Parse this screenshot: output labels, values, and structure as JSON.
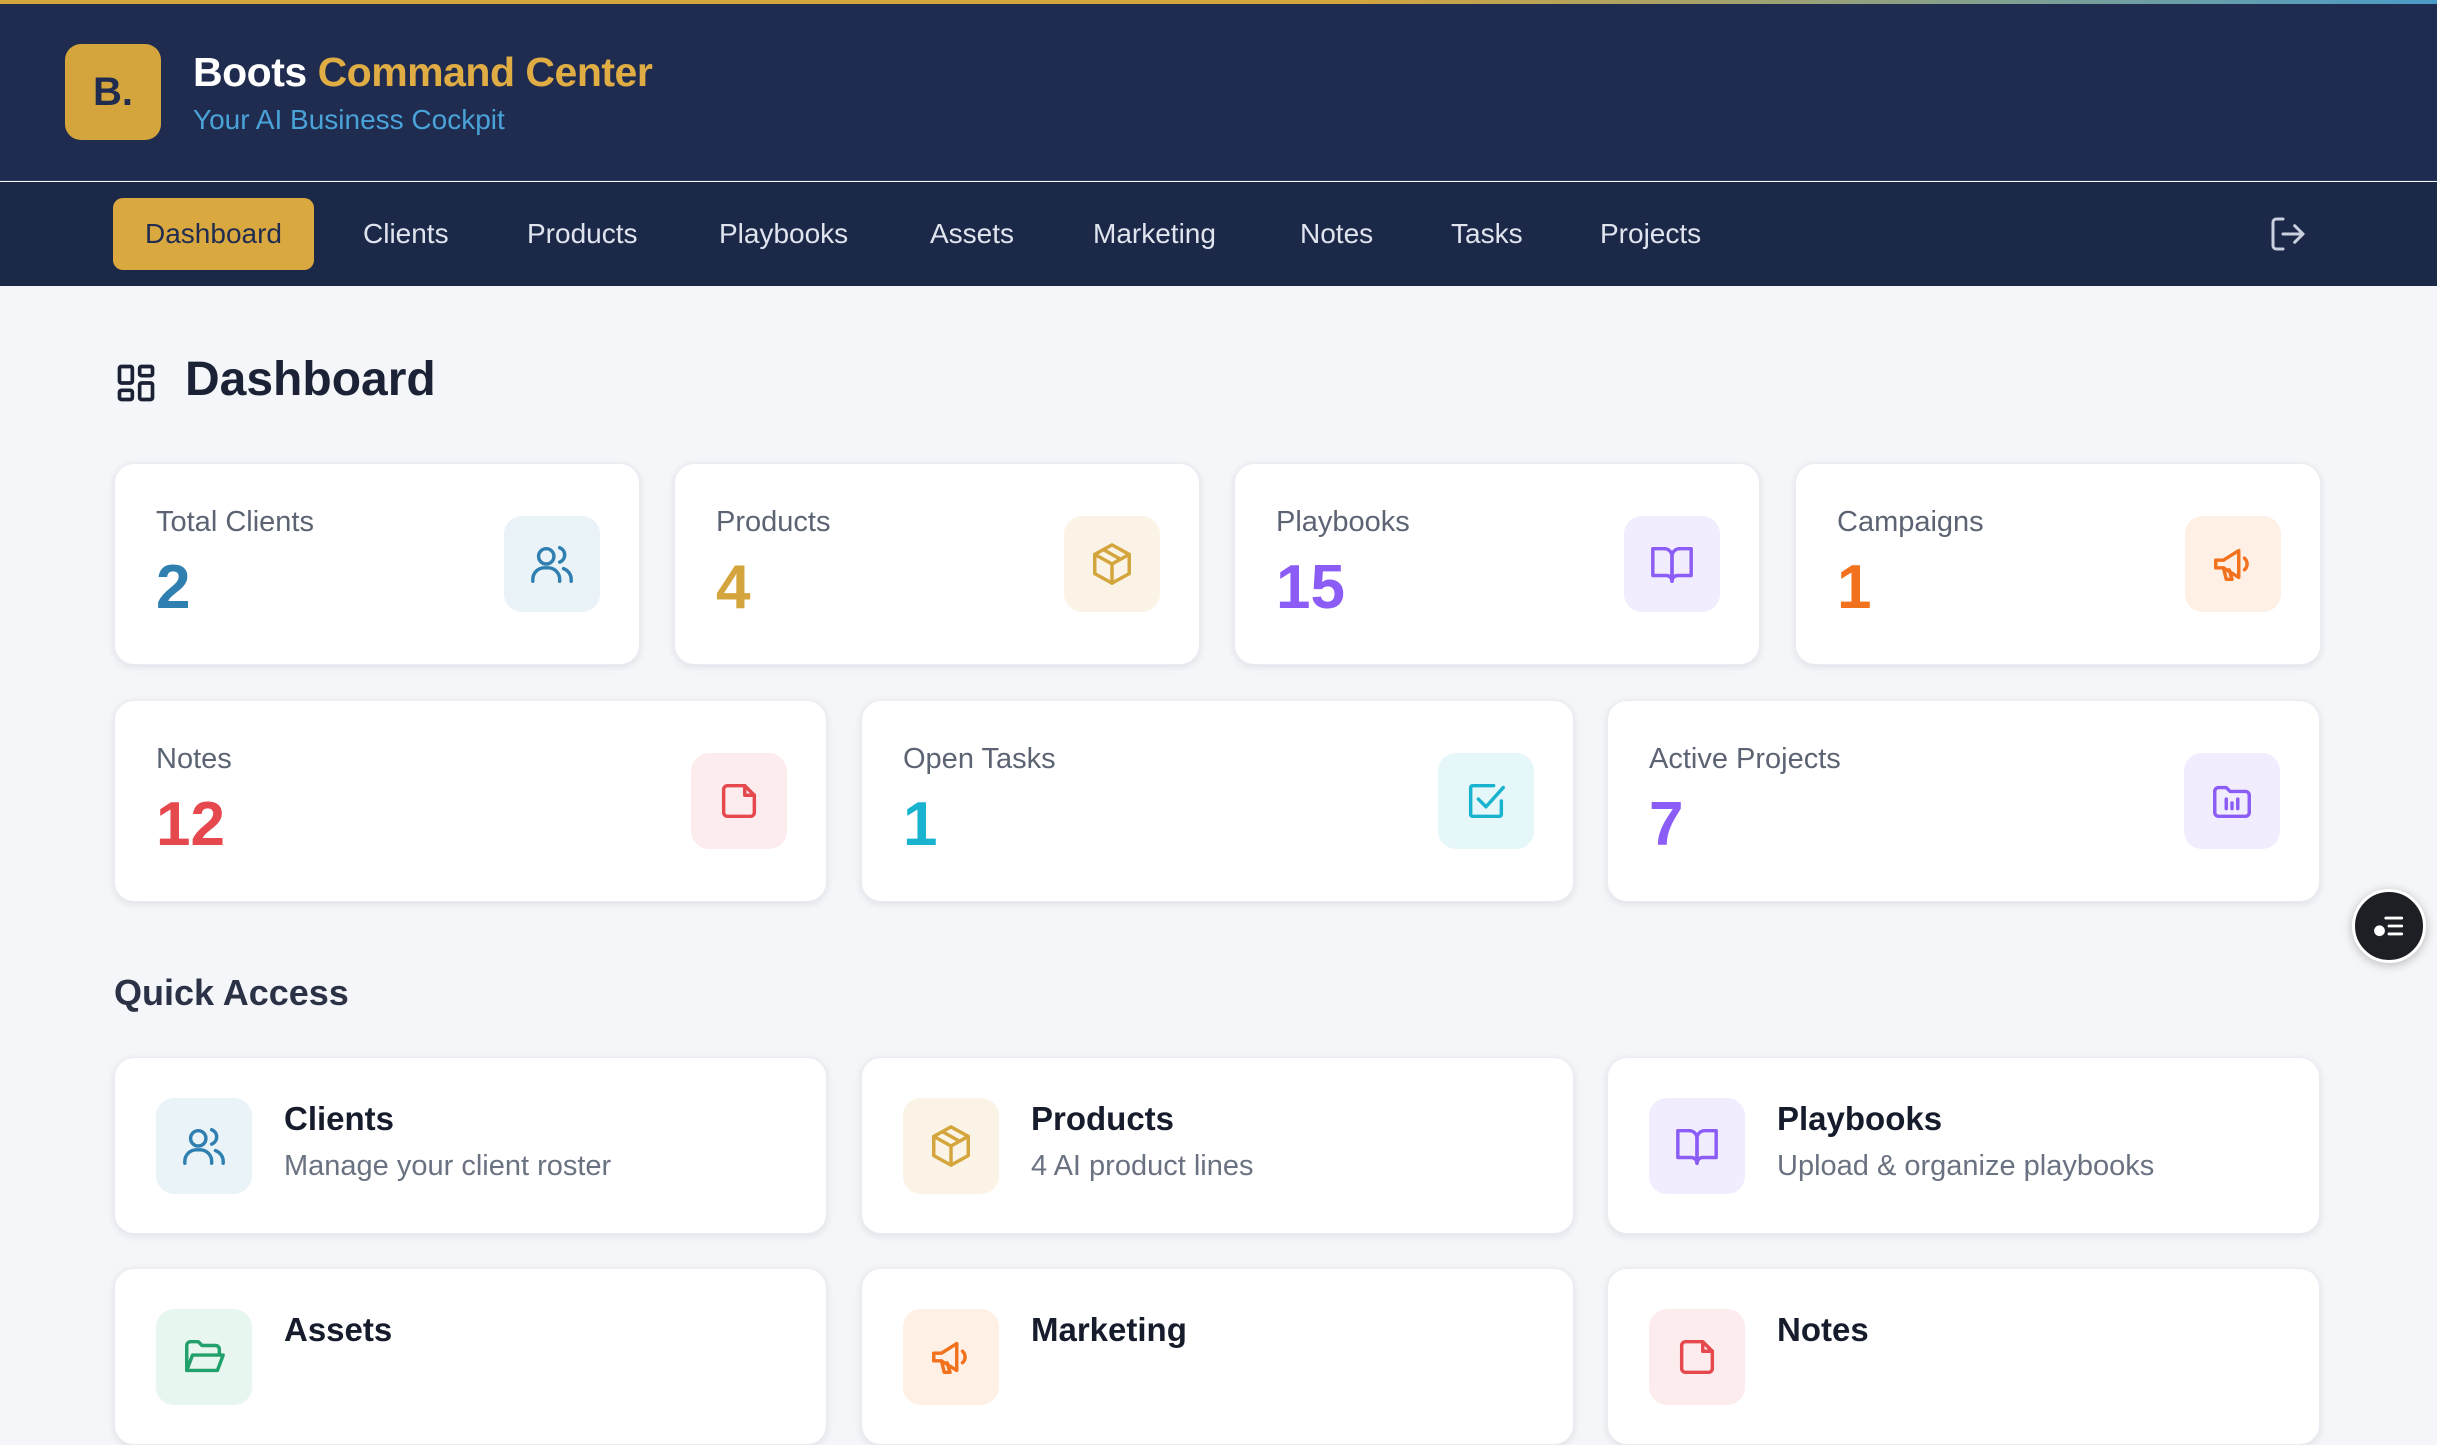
{
  "brand": {
    "logo": "B.",
    "title_main": "Boots",
    "title_accent": "Command Center",
    "subtitle": "Your AI Business Cockpit"
  },
  "nav": {
    "items": [
      "Dashboard",
      "Clients",
      "Products",
      "Playbooks",
      "Assets",
      "Marketing",
      "Notes",
      "Tasks",
      "Projects"
    ],
    "active": "Dashboard",
    "logout_icon": "logout-icon"
  },
  "page": {
    "title": "Dashboard",
    "title_icon": "grid-icon"
  },
  "stats": [
    {
      "label": "Total Clients",
      "value": "2",
      "icon": "users-icon",
      "color": "#2f7fb0",
      "bg": "#eaf3f8"
    },
    {
      "label": "Products",
      "value": "4",
      "icon": "box-icon",
      "color": "#d4a53c",
      "bg": "#fbf4e6"
    },
    {
      "label": "Playbooks",
      "value": "15",
      "icon": "book-icon",
      "color": "#8b5cf6",
      "bg": "#f1ecfe"
    },
    {
      "label": "Campaigns",
      "value": "1",
      "icon": "megaphone-icon",
      "color": "#f2711c",
      "bg": "#fff0e6"
    },
    {
      "label": "Notes",
      "value": "12",
      "icon": "note-icon",
      "color": "#e5484d",
      "bg": "#fdeced"
    },
    {
      "label": "Open Tasks",
      "value": "1",
      "icon": "check-square-icon",
      "color": "#18b3cf",
      "bg": "#e6f7fa"
    },
    {
      "label": "Active Projects",
      "value": "7",
      "icon": "folder-chart-icon",
      "color": "#8b5cf6",
      "bg": "#f1ecfe"
    }
  ],
  "quick_access": {
    "title": "Quick Access",
    "items": [
      {
        "title": "Clients",
        "desc": "Manage your client roster",
        "icon": "users-icon",
        "color": "#2f7fb0",
        "bg": "#eaf3f8"
      },
      {
        "title": "Products",
        "desc": "4 AI product lines",
        "icon": "box-icon",
        "color": "#d4a53c",
        "bg": "#fbf4e6"
      },
      {
        "title": "Playbooks",
        "desc": "Upload & organize playbooks",
        "icon": "book-icon",
        "color": "#8b5cf6",
        "bg": "#f1ecfe"
      },
      {
        "title": "Assets",
        "desc": "",
        "icon": "folder-open-icon",
        "color": "#22a06b",
        "bg": "#e7f6ee"
      },
      {
        "title": "Marketing",
        "desc": "",
        "icon": "megaphone-icon",
        "color": "#f2711c",
        "bg": "#fff0e6"
      },
      {
        "title": "Notes",
        "desc": "",
        "icon": "note-icon",
        "color": "#e5484d",
        "bg": "#fdeced"
      }
    ]
  },
  "floating": {
    "icon": "assistant-menu-icon"
  }
}
